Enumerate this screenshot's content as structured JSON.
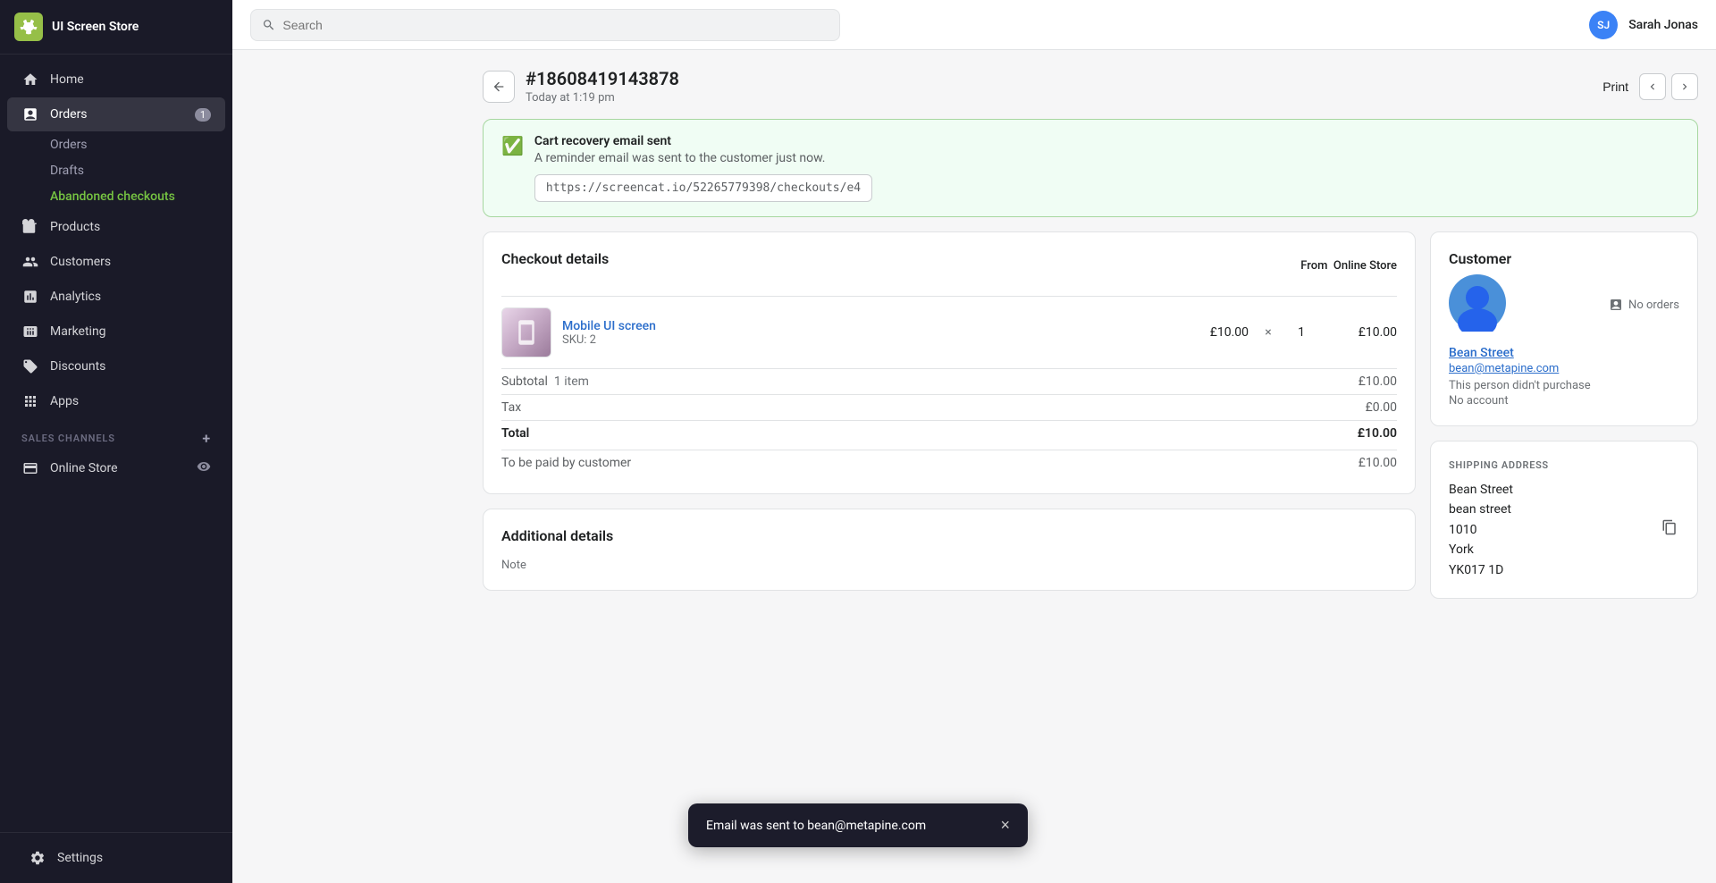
{
  "app": {
    "store_name": "UI Screen Store",
    "search_placeholder": "Search"
  },
  "user": {
    "initials": "SJ",
    "name": "Sarah Jonas"
  },
  "sidebar": {
    "nav_items": [
      {
        "id": "home",
        "label": "Home",
        "icon": "home"
      },
      {
        "id": "orders",
        "label": "Orders",
        "icon": "orders",
        "badge": "1"
      },
      {
        "id": "products",
        "label": "Products",
        "icon": "products"
      },
      {
        "id": "customers",
        "label": "Customers",
        "icon": "customers"
      },
      {
        "id": "analytics",
        "label": "Analytics",
        "icon": "analytics"
      },
      {
        "id": "marketing",
        "label": "Marketing",
        "icon": "marketing"
      },
      {
        "id": "discounts",
        "label": "Discounts",
        "icon": "discounts"
      },
      {
        "id": "apps",
        "label": "Apps",
        "icon": "apps"
      }
    ],
    "sub_items": [
      {
        "id": "orders-sub",
        "label": "Orders",
        "parent": "orders"
      },
      {
        "id": "drafts",
        "label": "Drafts",
        "parent": "orders"
      },
      {
        "id": "abandoned-checkouts",
        "label": "Abandoned checkouts",
        "parent": "orders",
        "active": true
      }
    ],
    "sales_channels_label": "SALES CHANNELS",
    "sales_channels": [
      {
        "id": "online-store",
        "label": "Online Store"
      }
    ],
    "settings_label": "Settings"
  },
  "page": {
    "order_number": "#18608419143878",
    "timestamp": "Today at 1:19 pm",
    "print_label": "Print"
  },
  "alert": {
    "title": "Cart recovery email sent",
    "body": "A reminder email was sent to the customer just now.",
    "url": "https://screencat.io/52265779398/checkouts/e4"
  },
  "checkout": {
    "section_title": "Checkout details",
    "from_label": "From",
    "source": "Online Store",
    "product": {
      "name": "Mobile UI screen",
      "sku": "SKU: 2",
      "price": "£10.00",
      "qty_separator": "×",
      "qty": "1",
      "total": "£10.00"
    },
    "subtotal_label": "Subtotal",
    "subtotal_items": "1 item",
    "subtotal_value": "£10.00",
    "tax_label": "Tax",
    "tax_value": "£0.00",
    "total_label": "Total",
    "total_value": "£10.00",
    "paid_by_label": "To be paid by customer",
    "paid_by_value": "£10.00"
  },
  "customer": {
    "section_title": "Customer",
    "no_orders": "No orders",
    "name": "Bean Street",
    "email": "bean@metapine.com",
    "note": "This person didn't purchase",
    "account": "No account"
  },
  "shipping": {
    "section_title": "SHIPPING ADDRESS",
    "lines": [
      "Bean Street",
      "bean street",
      "1010",
      "York",
      "YK017 1D"
    ]
  },
  "additional": {
    "section_title": "Additional details",
    "note_label": "Note"
  },
  "toast": {
    "message": "Email was sent to bean@metapine.com",
    "close": "×"
  }
}
